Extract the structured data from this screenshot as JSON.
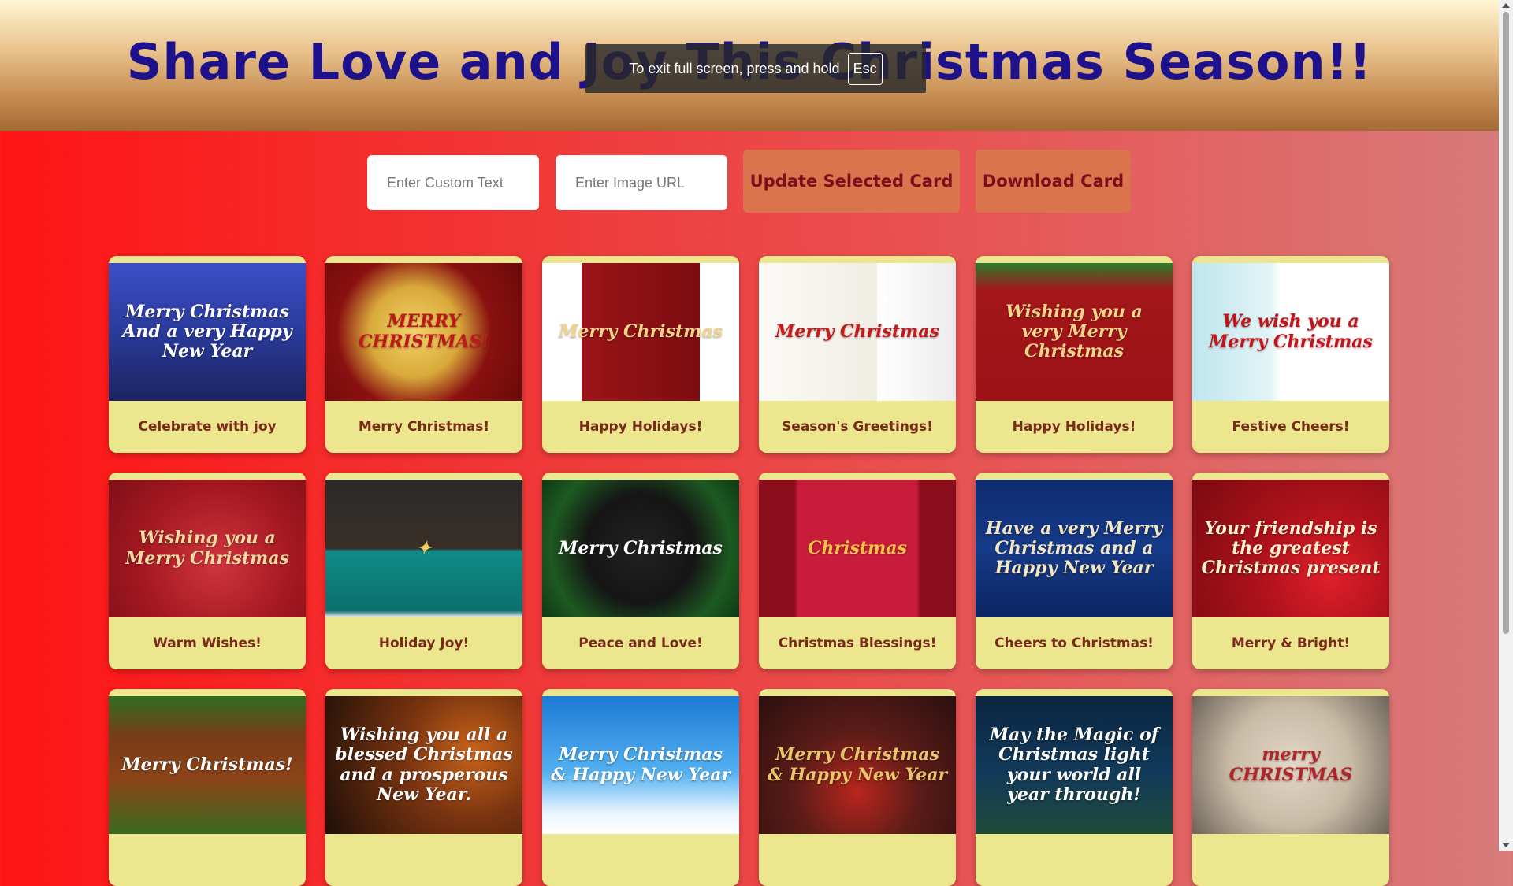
{
  "header": {
    "title": "Share Love and Joy This Christmas Season!!"
  },
  "fullscreen_toast": {
    "text": "To exit full screen, press and hold",
    "key": "Esc"
  },
  "controls": {
    "custom_text_placeholder": "Enter Custom Text",
    "image_url_placeholder": "Enter Image URL",
    "update_button": "Update Selected Card",
    "download_button": "Download Card"
  },
  "cards": [
    {
      "label": "Celebrate with joy",
      "image_text": "Merry Christmas And a very Happy New Year",
      "bg": "linear-gradient(180deg,#3d4fc8 0%,#2a3a9a 50%,#1c2460 100%)",
      "color": "#ffffff"
    },
    {
      "label": "Merry Christmas!",
      "image_text": "MERRY CHRISTMAS!",
      "bg": "radial-gradient(circle at 45% 50%,#f2d36b 0%,#d9a93a 35%,#8a1010 60%,#6a0a0a 100%)",
      "color": "#c01818"
    },
    {
      "label": "Happy Holidays!",
      "image_text": "Merry Christmas",
      "bg": "linear-gradient(90deg,#ffffff 0%,#ffffff 20%,#9a1418 20%,#7c0c10 80%,#ffffff 80%)",
      "color": "#f2d58a"
    },
    {
      "label": "Season's Greetings!",
      "image_text": "Merry Christmas",
      "bg": "linear-gradient(90deg,#fbfaf6 0%,#f0ede4 60%,#ffffff 60%,#ececec 100%)",
      "color": "#c41a1a"
    },
    {
      "label": "Happy Holidays!",
      "image_text": "Wishing you a very Merry Christmas",
      "bg": "linear-gradient(180deg,#2d7a2a 0%,#a4161a 20%,#9b1216 100%)",
      "color": "#f2d58a"
    },
    {
      "label": "Festive Cheers!",
      "image_text": "We wish you a Merry Christmas",
      "bg": "linear-gradient(90deg,#bfe6ee 0%,#e3f4f6 40%,#ffffff 45%,#ffffff 100%)",
      "color": "#c0141a"
    },
    {
      "label": "Warm Wishes!",
      "image_text": "Wishing you a Merry Christmas",
      "bg": "radial-gradient(circle at 55% 60%,#d0353e 0%,#a51822 55%,#7e0f17 100%)",
      "color": "#f1d9a2"
    },
    {
      "label": "Holiday Joy!",
      "image_text": "✦",
      "bg": "linear-gradient(180deg,#2a2a2a 0%,#3a2f28 50%,#0f8c87 52%,#0c6f6c 95%,#f5f5f5 100%)",
      "color": "#f2cf63"
    },
    {
      "label": "Peace and Love!",
      "image_text": "Merry Christmas",
      "bg": "radial-gradient(circle at 50% 50%,#222 0%,#151515 45%,#1d5a22 75%,#0f3814 100%)",
      "color": "#ffffff"
    },
    {
      "label": "Christmas Blessings!",
      "image_text": "Christmas",
      "bg": "linear-gradient(90deg,#8a0d1c 0%,#8a0d1c 18%,#c81c3a 20%,#c81c3a 80%,#8a0d1c 82%)",
      "color": "#f4c542"
    },
    {
      "label": "Cheers to Christmas!",
      "image_text": "Have a very Merry Christmas and a Happy New Year",
      "bg": "linear-gradient(180deg,#0e2b6e 0%,#163a8a 50%,#0c2560 100%)",
      "color": "#f3e6c2"
    },
    {
      "label": "Merry & Bright!",
      "image_text": "Your friendship is the greatest Christmas present",
      "bg": "radial-gradient(circle at 70% 70%,#e0202a 0%,#b0121c 40%,#7a0a10 100%)",
      "color": "#fff0d2"
    },
    {
      "label": "",
      "image_text": "Merry Christmas!",
      "bg": "linear-gradient(180deg,#2f6e21 0%,#7a3a18 30%,#8b4418 60%,#3a6a20 100%)",
      "color": "#ffffff"
    },
    {
      "label": "",
      "image_text": "Wishing you all a blessed Christmas and a prosperous New Year.",
      "bg": "radial-gradient(circle at 75% 40%,#c9631a 0%,#7a3410 40%,#1e0f08 100%)",
      "color": "#ffffff"
    },
    {
      "label": "",
      "image_text": "Merry Christmas & Happy New Year",
      "bg": "linear-gradient(180deg,#1d7ad6 0%,#52b0f0 55%,#eaf6ff 85%,#ffffff 100%)",
      "color": "#ffffff"
    },
    {
      "label": "",
      "image_text": "Merry Christmas & Happy New Year",
      "bg": "radial-gradient(circle at 50% 70%,#b8261d 0%,#5b1c18 45%,#2b0f0d 100%)",
      "color": "#e9c36a"
    },
    {
      "label": "",
      "image_text": "May the Magic of Christmas light your world all year through!",
      "bg": "linear-gradient(180deg,#0a2540 0%,#123a5a 55%,#1f4a3a 100%)",
      "color": "#ffffff"
    },
    {
      "label": "",
      "image_text": "merry CHRISTMAS",
      "bg": "radial-gradient(circle at 50% 50%,#e2d7c6 0%,#c8bba6 50%,#6d6458 100%)",
      "color": "#b3232a"
    }
  ]
}
